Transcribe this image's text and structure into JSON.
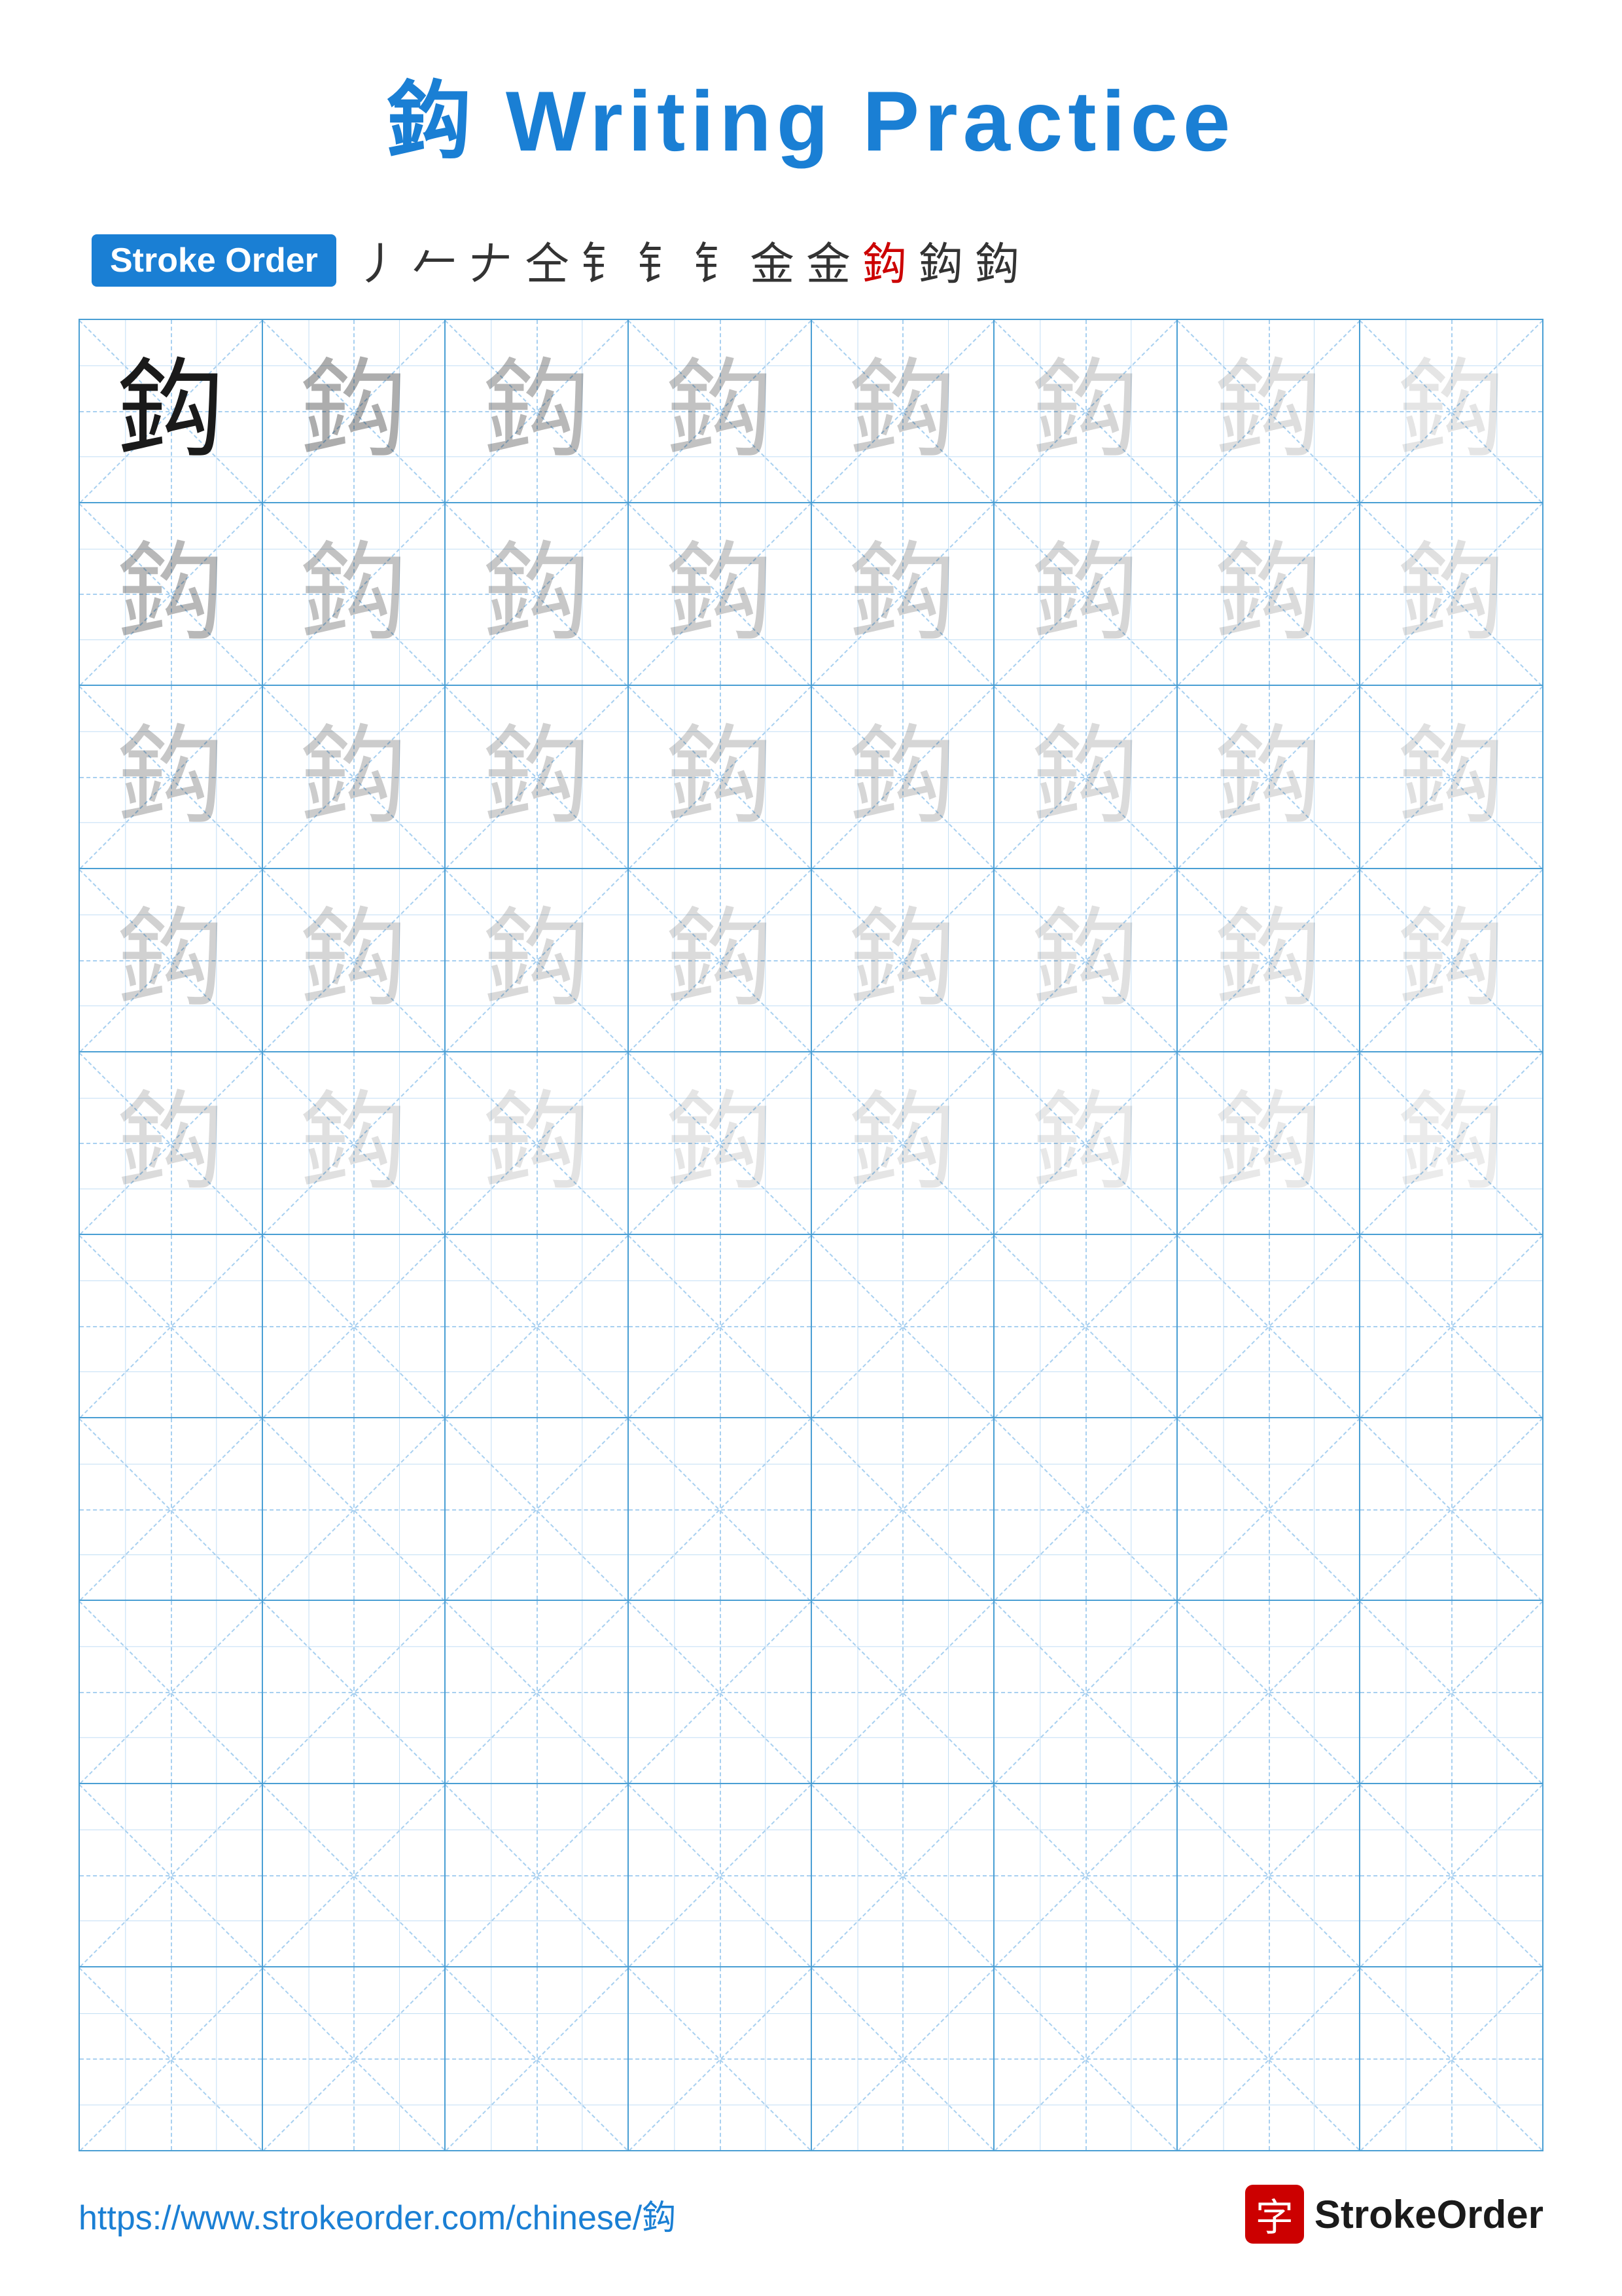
{
  "title": {
    "char": "鈎",
    "text": " Writing Practice"
  },
  "stroke_order": {
    "badge_label": "Stroke Order",
    "strokes": [
      "丿",
      "亻",
      "𠂉",
      "仝",
      "钅",
      "钅",
      "钅",
      "金",
      "金'",
      "鈎",
      "鈎",
      "鈎"
    ]
  },
  "grid": {
    "char": "鈎",
    "rows": 10,
    "cols": 8
  },
  "footer": {
    "url": "https://www.strokeorder.com/chinese/鈎",
    "logo_char": "字",
    "logo_text": "StrokeOrder"
  }
}
